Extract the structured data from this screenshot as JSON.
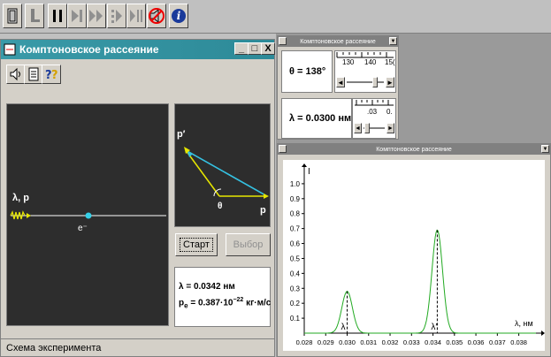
{
  "toolbar": {
    "icons": [
      "open-icon",
      "stop-icon",
      "pause-icon",
      "step-icon",
      "fast-forward-icon",
      "step-in-icon",
      "step-out-icon",
      "sound-off-icon",
      "info-icon"
    ]
  },
  "main_window": {
    "title": "Комптоновское рассеяние",
    "minimize": "_",
    "restore": "□",
    "close": "X",
    "scheme": {
      "incident_label": "λ, p",
      "electron_label": "e⁻"
    },
    "vectors": {
      "p_scattered": "p′",
      "p_incident": "p",
      "angle": "θ"
    },
    "buttons": {
      "start": "Старт",
      "choice": "Выбор"
    },
    "result": {
      "lambda_text": "λ = 0.0342 нм",
      "pe_prefix": "p",
      "pe_sub": "e",
      "pe_value": " = 0.387·10",
      "pe_exp": "−22",
      "pe_unit": " кг·м/с"
    },
    "status": "Схема эксперимента"
  },
  "param_panel": {
    "title": "Комптоновское рассеяние",
    "theta_label": "θ = 138°",
    "theta_value": 138,
    "theta_ticks": [
      "130",
      "140",
      "15("
    ],
    "lambda_label": "λ = 0.0300 нм",
    "lambda_value": 0.03,
    "lambda_ticks": [
      ".03",
      "0."
    ]
  },
  "graph_panel": {
    "title": "Комптоновское рассеяние"
  },
  "chart_data": {
    "type": "line",
    "title": "",
    "xlabel": "λ, нм",
    "ylabel": "I",
    "xlim": [
      0.028,
      0.0388
    ],
    "ylim": [
      0,
      1.1
    ],
    "x_ticks": [
      "0.028",
      "0.029",
      "0.030",
      "0.031",
      "0.032",
      "0.033",
      "0.034",
      "0.035",
      "0.036",
      "0.037",
      "0.038"
    ],
    "y_ticks": [
      "0.1",
      "0.2",
      "0.3",
      "0.4",
      "0.5",
      "0.6",
      "0.7",
      "0.8",
      "0.9",
      "1.0"
    ],
    "line_color": "#22aa22",
    "peaks": [
      {
        "label": "λ",
        "center": 0.03,
        "height": 0.28,
        "width": 0.00035
      },
      {
        "label": "λ′",
        "center": 0.0342,
        "height": 0.69,
        "width": 0.00035
      }
    ]
  }
}
